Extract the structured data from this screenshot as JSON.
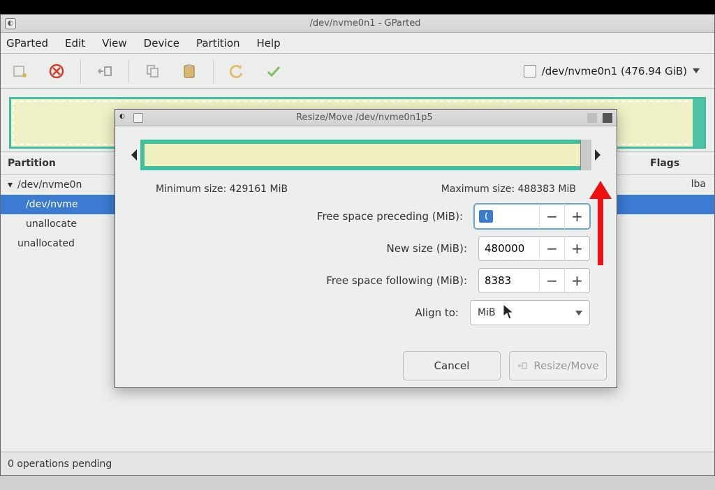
{
  "window": {
    "title": "/dev/nvme0n1 - GParted"
  },
  "menubar": {
    "gparted": "GParted",
    "edit": "Edit",
    "view": "View",
    "device": "Device",
    "partition": "Partition",
    "help": "Help"
  },
  "device_selector": {
    "label": "/dev/nvme0n1  (476.94 GiB)"
  },
  "columns": {
    "partition": "Partition",
    "flags": "Flags"
  },
  "rows": {
    "parent": "/dev/nvme0n",
    "selected": "/dev/nvme",
    "unallocated1": "unallocate",
    "unallocated2": "unallocated",
    "flags_lba": "lba"
  },
  "statusbar": {
    "text": "0 operations pending"
  },
  "dialog": {
    "title": "Resize/Move /dev/nvme0n1p5",
    "min_label": "Minimum size: 429161 MiB",
    "max_label": "Maximum size: 488383 MiB",
    "free_preceding_label": "Free space preceding (MiB):",
    "free_preceding_value": "0",
    "new_size_label": "New size (MiB):",
    "new_size_value": "480000",
    "free_following_label": "Free space following (MiB):",
    "free_following_value": "8383",
    "align_label": "Align to:",
    "align_value": "MiB",
    "cancel": "Cancel",
    "apply": "Resize/Move"
  }
}
